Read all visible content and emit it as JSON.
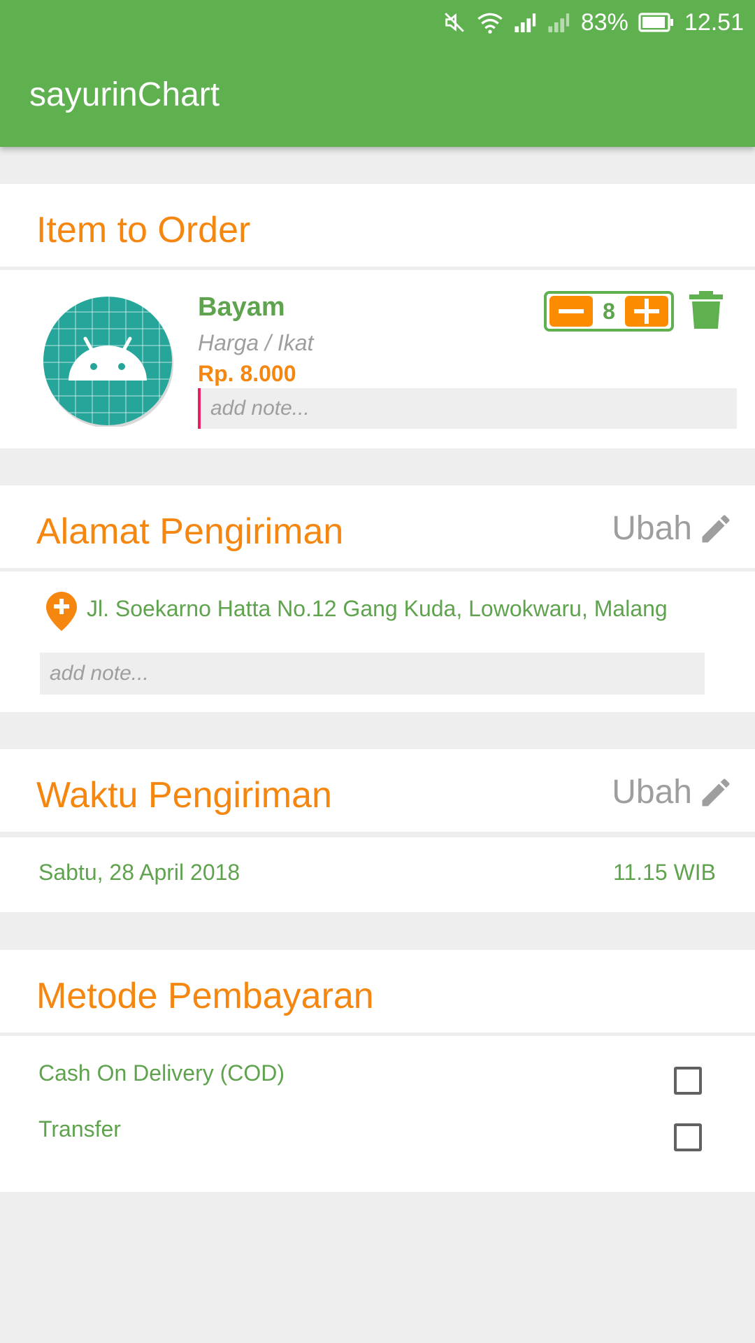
{
  "status_bar": {
    "battery_percent": "83%",
    "time": "12.51"
  },
  "app_bar": {
    "title": "sayurinChart"
  },
  "item_section": {
    "title": "Item to Order",
    "item": {
      "name": "Bayam",
      "unit": "Harga / Ikat",
      "price": "Rp. 8.000",
      "quantity": "8",
      "note_placeholder": "add note..."
    }
  },
  "address_section": {
    "title": "Alamat Pengiriman",
    "edit_label": "Ubah",
    "address": "Jl. Soekarno Hatta No.12 Gang Kuda, Lowokwaru, Malang",
    "note_placeholder": "add note..."
  },
  "time_section": {
    "title": "Waktu Pengiriman",
    "edit_label": "Ubah",
    "date": "Sabtu, 28 April 2018",
    "time": "11.15 WIB"
  },
  "payment_section": {
    "title": "Metode Pembayaran",
    "options": [
      {
        "label": "Cash On Delivery (COD)",
        "checked": false
      },
      {
        "label": "Transfer",
        "checked": false
      }
    ]
  },
  "colors": {
    "primary_green": "#5fb14f",
    "accent_orange": "#f5860f",
    "text_green": "#5fa34f",
    "muted_gray": "#9e9e9e"
  }
}
